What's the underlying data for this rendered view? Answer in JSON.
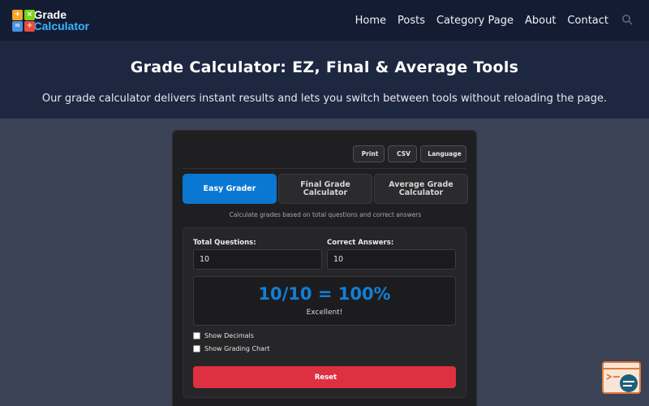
{
  "header": {
    "logo_line1": "Grade",
    "logo_line2": "Calculator",
    "nav": [
      "Home",
      "Posts",
      "Category Page",
      "About",
      "Contact"
    ]
  },
  "hero": {
    "title": "Grade Calculator: EZ, Final & Average Tools",
    "description": "Our grade calculator delivers instant results and lets you switch between tools without reloading the page."
  },
  "toolbar": {
    "print_icon": "",
    "print_label": "Print",
    "csv_icon": "",
    "csv_label": "CSV",
    "language_icon": "",
    "language_label": "Language"
  },
  "tabs": [
    {
      "label": "Easy Grader",
      "active": true
    },
    {
      "label": "Final Grade Calculator",
      "active": false
    },
    {
      "label": "Average Grade Calculator",
      "active": false
    }
  ],
  "calculator": {
    "subtitle": "Calculate grades based on total questions and correct answers",
    "total_label": "Total Questions:",
    "total_value": "10",
    "correct_label": "Correct Answers:",
    "correct_value": "10",
    "result": "10/10 = 100%",
    "message": "Excellent! ",
    "show_decimals": "Show Decimals",
    "show_chart": "Show Grading Chart",
    "reset_icon": "",
    "reset_label": "Reset"
  },
  "colors": {
    "accent": "#0a78d2",
    "danger": "#dd3040",
    "header_bg": "#141c33"
  }
}
